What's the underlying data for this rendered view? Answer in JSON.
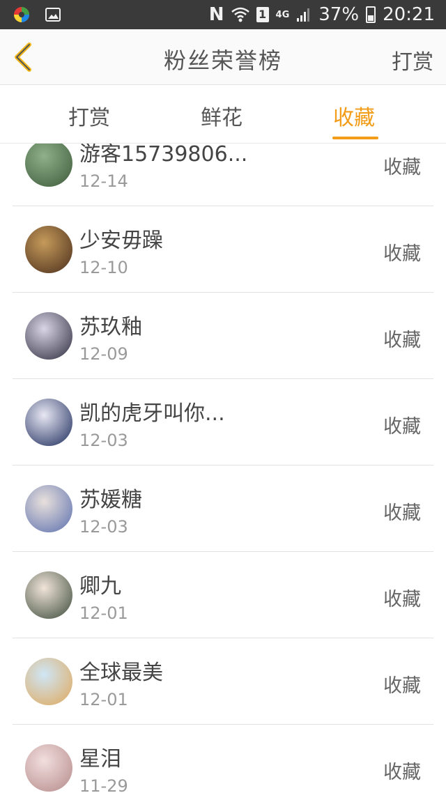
{
  "status_bar": {
    "signal_label": "4G",
    "sim_label": "1",
    "nfc_label": "N",
    "battery": "37%",
    "time": "20:21"
  },
  "header": {
    "title": "粉丝荣誉榜",
    "right_action": "打赏"
  },
  "tabs": [
    {
      "label": "打赏",
      "active": false
    },
    {
      "label": "鲜花",
      "active": false
    },
    {
      "label": "收藏",
      "active": true
    }
  ],
  "accent_color": "#f29c17",
  "list": [
    {
      "name": "游客15739806...",
      "date": "12-14",
      "action": "收藏",
      "avatar_colors": [
        "#8fb08a",
        "#3d5a3a"
      ]
    },
    {
      "name": "少安毋躁",
      "date": "12-10",
      "action": "收藏",
      "avatar_colors": [
        "#c59a5a",
        "#4a2e1c"
      ]
    },
    {
      "name": "苏玖釉",
      "date": "12-09",
      "action": "收藏",
      "avatar_colors": [
        "#d9d4e6",
        "#2b2b3c"
      ]
    },
    {
      "name": "凯的虎牙叫你...",
      "date": "12-03",
      "action": "收藏",
      "avatar_colors": [
        "#e8e8f4",
        "#1b2a5a"
      ]
    },
    {
      "name": "苏媛糖",
      "date": "12-03",
      "action": "收藏",
      "avatar_colors": [
        "#e8e0dc",
        "#5b6fae"
      ]
    },
    {
      "name": "卿九",
      "date": "12-01",
      "action": "收藏",
      "avatar_colors": [
        "#f0e4d8",
        "#3a4a3a"
      ]
    },
    {
      "name": "全球最美",
      "date": "12-01",
      "action": "收藏",
      "avatar_colors": [
        "#cfe6f6",
        "#e0a85a"
      ]
    },
    {
      "name": "星泪",
      "date": "11-29",
      "action": "收藏",
      "avatar_colors": [
        "#f2dede",
        "#b58a8a"
      ]
    }
  ]
}
